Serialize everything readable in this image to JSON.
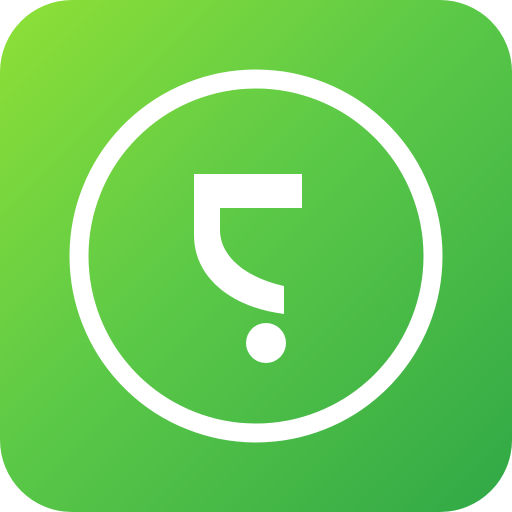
{
  "app_icon": {
    "icon_name": "question-mark-circle-icon",
    "colors": {
      "gradient_start": "#8FE036",
      "gradient_mid": "#5CC947",
      "gradient_end": "#30A846",
      "glyph": "#FFFFFF"
    }
  }
}
